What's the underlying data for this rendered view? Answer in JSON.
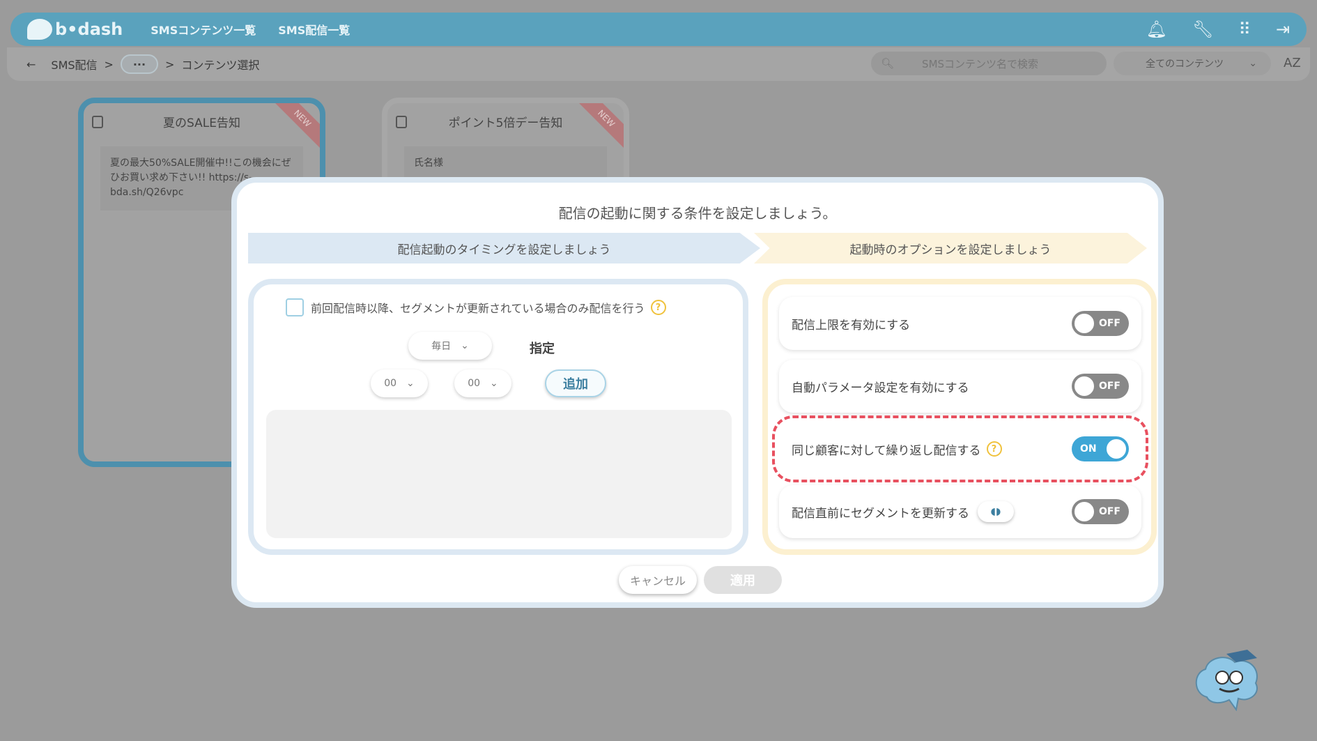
{
  "header": {
    "logo_text": "b•dash",
    "nav": [
      "SMSコンテンツ一覧",
      "SMS配信一覧"
    ]
  },
  "breadcrumb": {
    "root": "SMS配信",
    "sep": ">",
    "dots": "···",
    "current": "コンテンツ選択"
  },
  "search": {
    "placeholder": "SMSコンテンツ名で検索"
  },
  "filter": {
    "selected": "全てのコンテンツ"
  },
  "sort_label": "AZ",
  "cards": [
    {
      "title": "夏のSALE告知",
      "badge": "NEW",
      "body": "夏の最大50%SALE開催中!!この機会にぜひお買い求め下さい!! https://s-bda.sh/Q26vpc"
    },
    {
      "title": "ポイント5倍デー告知",
      "badge": "NEW",
      "body": "氏名様"
    }
  ],
  "modal": {
    "title": "配信の起動に関する条件を設定しましょう。",
    "step1": "配信起動のタイミングを設定しましょう",
    "step2": "起動時のオプションを設定しましょう",
    "left": {
      "checkbox_label": "前回配信時以降、セグメントが更新されている場合のみ配信を行う",
      "help": "?",
      "frequency": "毎日",
      "shitei": "指定",
      "hour": "00",
      "minute": "00",
      "colon": ":",
      "add": "追加"
    },
    "options": [
      {
        "label": "配信上限を有効にする",
        "state": "OFF"
      },
      {
        "label": "自動パラメータ設定を有効にする",
        "state": "OFF"
      },
      {
        "label": "同じ顧客に対して繰り返し配信する",
        "state": "ON"
      },
      {
        "label": "配信直前にセグメントを更新する",
        "state": "OFF"
      }
    ],
    "cancel": "キャンセル",
    "apply": "適用"
  }
}
